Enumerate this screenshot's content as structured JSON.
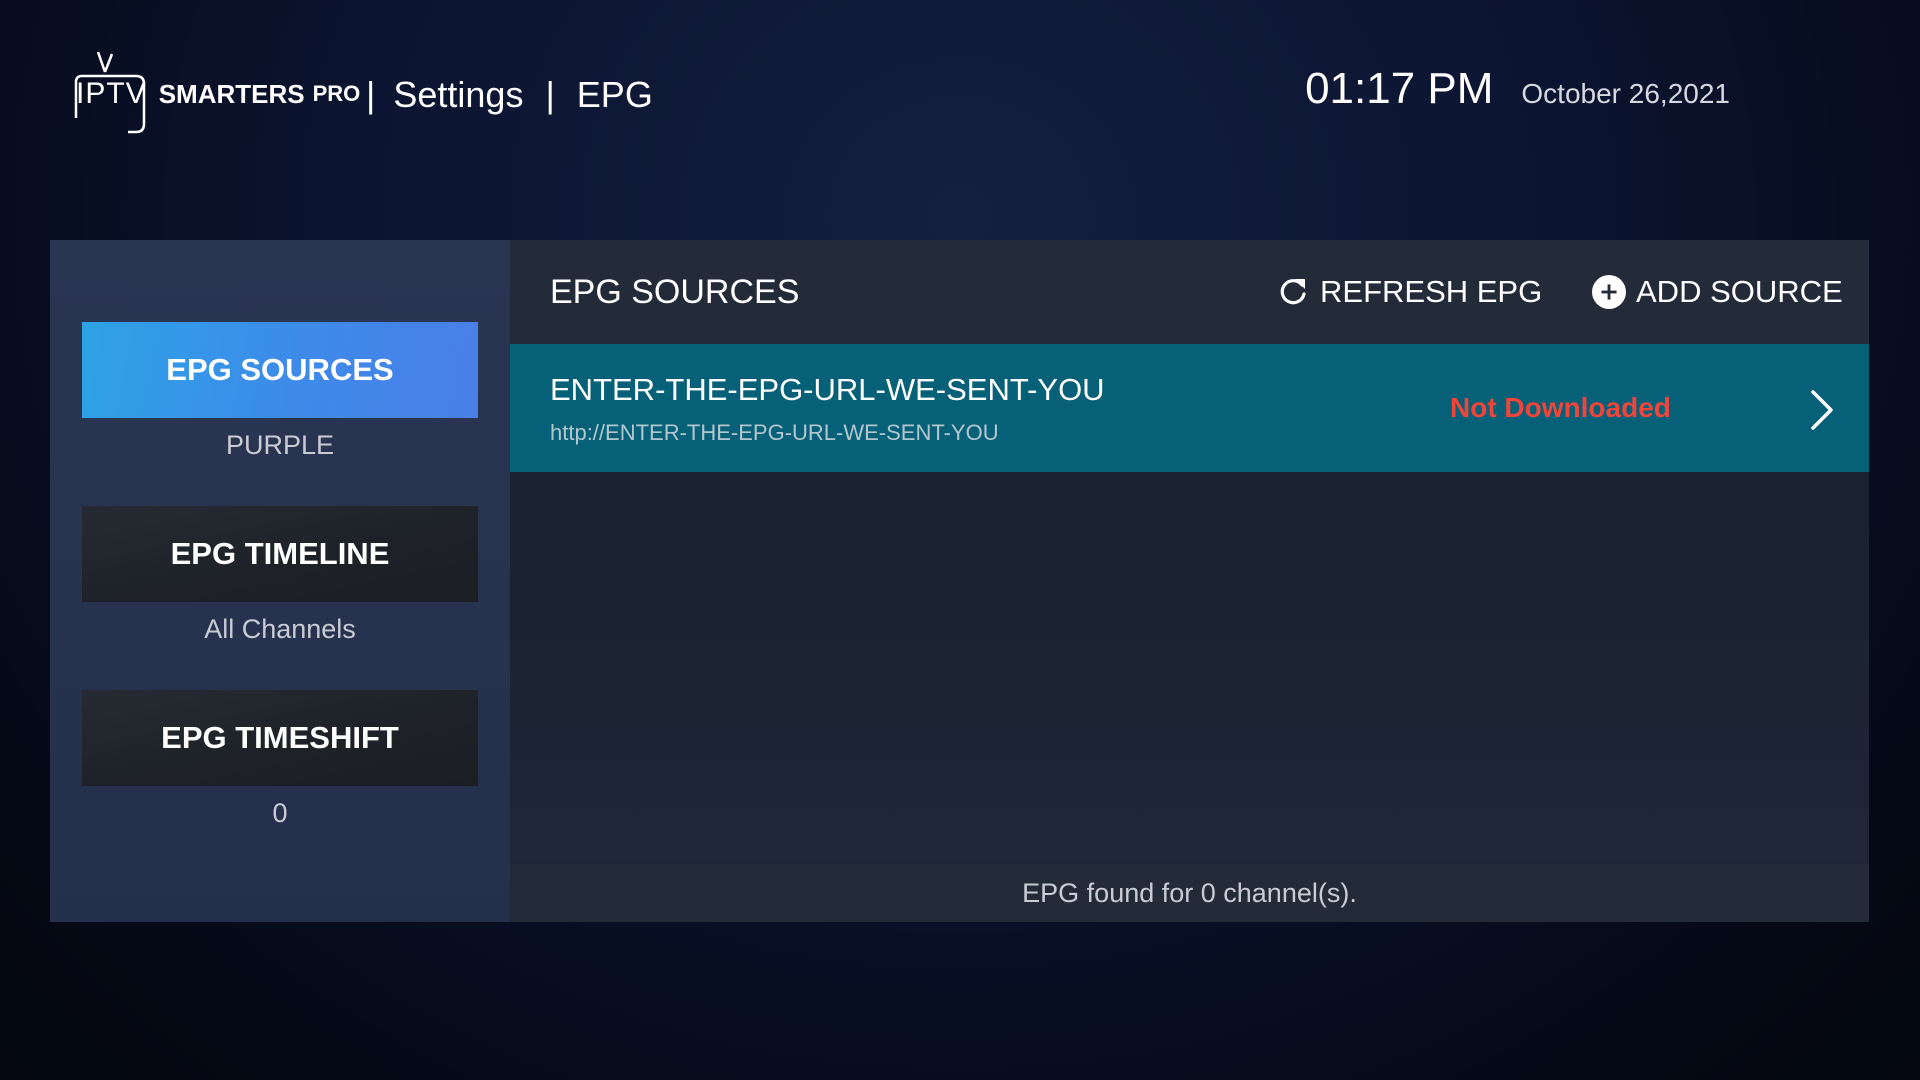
{
  "header": {
    "logo": {
      "iptv": "IPTV",
      "smarters": "SMARTERS",
      "pro": "PRO"
    },
    "breadcrumb": {
      "separator": "|",
      "section": "Settings",
      "page": "EPG"
    },
    "time": "01:17 PM",
    "date": "October 26,2021"
  },
  "sidebar": {
    "items": [
      {
        "label": "EPG SOURCES",
        "value": "PURPLE",
        "active": true
      },
      {
        "label": "EPG TIMELINE",
        "value": "All Channels",
        "active": false
      },
      {
        "label": "EPG TIMESHIFT",
        "value": "0",
        "active": false
      }
    ]
  },
  "content": {
    "title": "EPG SOURCES",
    "refresh_label": "REFRESH EPG",
    "refresh_icon": "refresh-icon",
    "add_label": "ADD SOURCE",
    "add_icon": "plus-circle-icon",
    "sources": [
      {
        "name": "ENTER-THE-EPG-URL-WE-SENT-YOU",
        "url": "http://ENTER-THE-EPG-URL-WE-SENT-YOU",
        "status": "Not Downloaded"
      }
    ],
    "footer": "EPG found for 0 channel(s)."
  },
  "colors": {
    "active_button": "#3d8ae9",
    "selected_row": "#066078",
    "status_error": "#f1453a"
  }
}
